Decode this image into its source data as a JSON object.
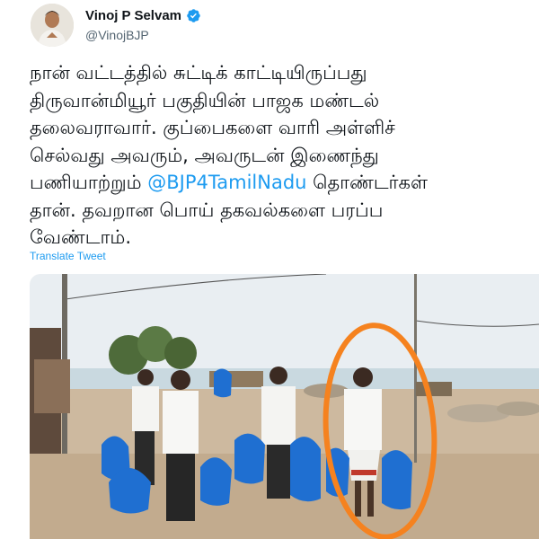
{
  "user": {
    "display_name": "Vinoj P Selvam",
    "handle": "@VinojBJP"
  },
  "tweet": {
    "line1": "நான் வட்டத்தில் சுட்டிக் காட்டியிருப்பது",
    "line2": "திருவான்மியூர் பகுதியின் பாஜக மண்டல்",
    "line3": "தலைவராவார். குப்பைகளை வாரி அள்ளிச்",
    "line4": "செல்வது அவரும், அவருடன் இணைந்து",
    "line5_before": "பணியாற்றும் ",
    "mention": "@BJP4TamilNadu",
    "line5_after": " தொண்டர்கள்",
    "line6": "தான். தவறான பொய் தகவல்களை பரப்ப",
    "line7": "வேண்டாம்.",
    "translate_label": "Translate Tweet"
  },
  "colors": {
    "link": "#1d9bf0",
    "verified": "#1d9bf0",
    "circle_highlight": "#f5821f",
    "bag_blue": "#1f6fd1"
  },
  "icons": {
    "verified": "verified-badge-icon"
  }
}
